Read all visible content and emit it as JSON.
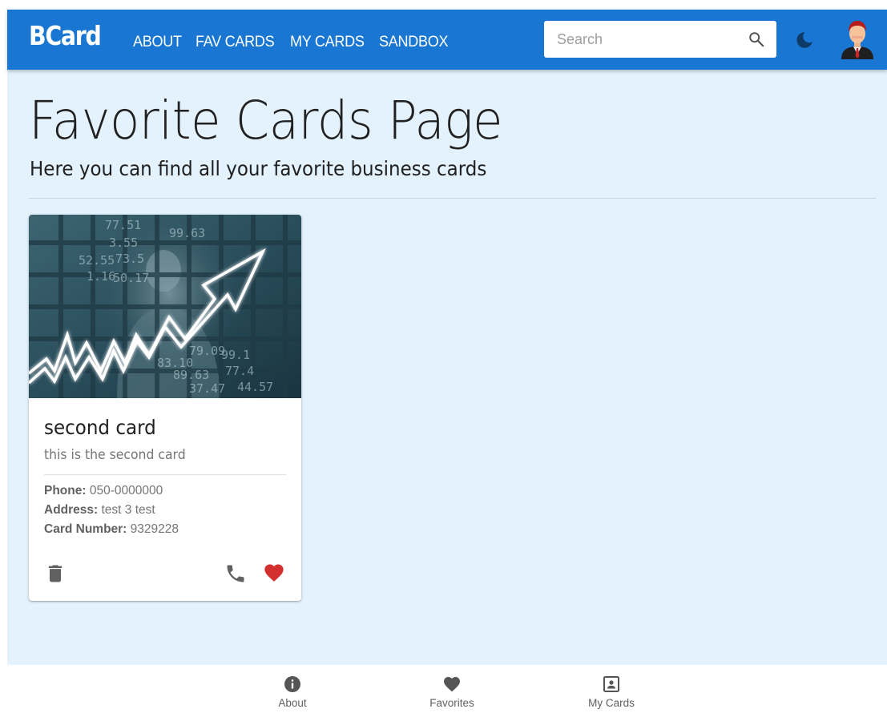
{
  "header": {
    "logo": "BCard",
    "nav": [
      "ABOUT",
      "FAV CARDS",
      "MY CARDS",
      "SANDBOX"
    ],
    "search_placeholder": "Search",
    "search_value": ""
  },
  "page": {
    "title": "Favorite Cards Page",
    "subtitle": "Here you can find all your favorite business cards"
  },
  "card": {
    "title": "second card",
    "subtitle": "this is the second card",
    "phone_label": "Phone:",
    "phone": "050-0000000",
    "address_label": "Address:",
    "address": "test 3 test",
    "number_label": "Card Number:",
    "number": "9329228",
    "image_numbers": [
      "77.51",
      "3.55",
      "52.55",
      "73.5",
      "1.16",
      "50.17",
      "99.63",
      "79.09",
      "83.10",
      "99.1",
      "89.63",
      "77.4",
      "37.47",
      "44.57"
    ]
  },
  "bottom_nav": [
    {
      "label": "About",
      "icon": "info-icon"
    },
    {
      "label": "Favorites",
      "icon": "heart-icon"
    },
    {
      "label": "My Cards",
      "icon": "contact-card-icon"
    }
  ],
  "colors": {
    "primary": "#1976d2",
    "background": "#e3f2fd",
    "favorite": "#d32f2f",
    "icon": "#616161",
    "moon": "#0d3b66"
  },
  "icons": [
    "search-icon",
    "moon-icon",
    "avatar",
    "trash-icon",
    "phone-icon",
    "heart-icon"
  ]
}
